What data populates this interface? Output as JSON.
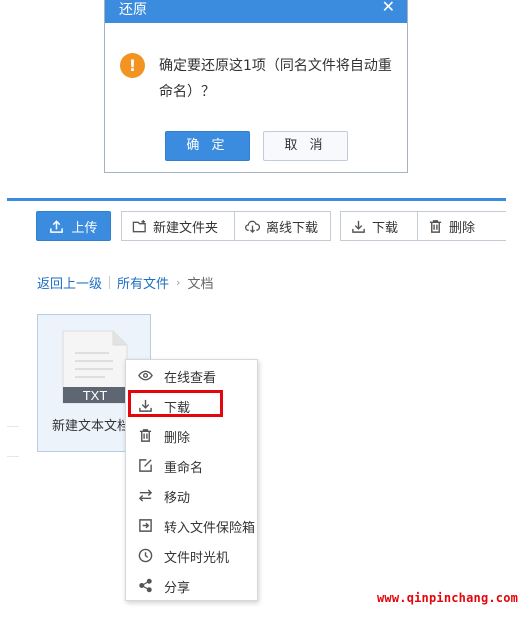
{
  "dialog": {
    "title": "还原",
    "close_glyph": "✕",
    "warning_glyph": "!",
    "message": "确定要还原这1项（同名文件将自动重命名）？",
    "ok_label": "确 定",
    "cancel_label": "取 消"
  },
  "toolbar": {
    "upload_label": "上传",
    "new_folder_label": "新建文件夹",
    "offline_download_label": "离线下载",
    "download_label": "下载",
    "delete_label": "删除"
  },
  "breadcrumb": {
    "back_label": "返回上一级",
    "all_files_label": "所有文件",
    "chevron": "›",
    "current_label": "文档"
  },
  "file": {
    "type_badge": "TXT",
    "name": "新建文本文档"
  },
  "context_menu": {
    "items": [
      {
        "label": "在线查看",
        "icon": "eye-icon"
      },
      {
        "label": "下载",
        "icon": "download-icon"
      },
      {
        "label": "删除",
        "icon": "trash-icon"
      },
      {
        "label": "重命名",
        "icon": "edit-icon"
      },
      {
        "label": "移动",
        "icon": "move-arrows-icon"
      },
      {
        "label": "转入文件保险箱",
        "icon": "vault-import-icon"
      },
      {
        "label": "文件时光机",
        "icon": "clock-icon"
      },
      {
        "label": "分享",
        "icon": "share-icon"
      }
    ],
    "highlight_color": "#e4060b"
  },
  "watermark": "www.qinpinchang.com",
  "colors": {
    "accent": "#3b8cde",
    "warning": "#f39322"
  }
}
